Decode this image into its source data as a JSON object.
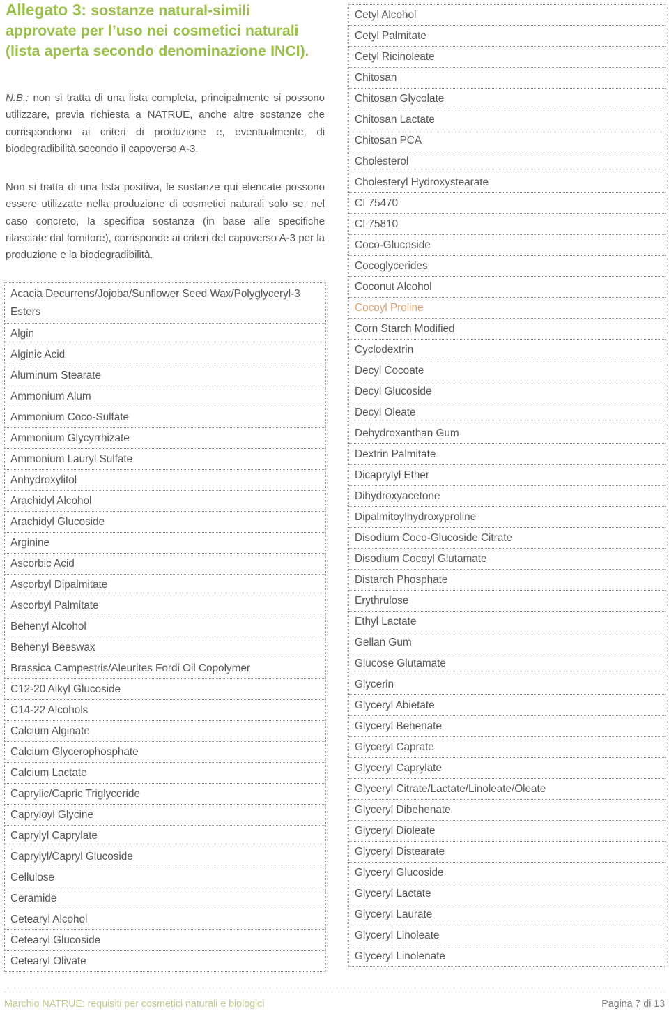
{
  "document": {
    "title_strong": "Allegato 3:",
    "title_rest": " sostanze natural-simili approvate per l’uso nei cosmetici naturali (lista aperta secondo denominazione INCI).",
    "nb_label": "N.B.:",
    "nb_text": " non si tratta di una lista completa, principalmente si possono utilizzare, previa richiesta a NATRUE, anche altre sostanze che corrispondono ai criteri di produzione e, eventualmente, di biodegradibilità secondo il capoverso A-3.",
    "paragraph_2": "Non si tratta di una lista positiva, le sostanze qui elencate possono essere utilizzate nella produzione di cosmetici naturali solo se, nel caso concreto, la specifica sostanza (in base alle specifiche rilasciate dal fornitore), corrisponde ai criteri del capoverso A-3 per la produzione e la biodegradibilità."
  },
  "colors": {
    "heading_green": "#9CC04C",
    "body_gray": "#58585A",
    "accent_tan": "#D9A273",
    "footer_green": "#BCCB8E",
    "footer_gray": "#808080",
    "dotted_rule": "#9A9A9A"
  },
  "substances_left": [
    "Acacia Decurrens/Jojoba/Sunflower Seed Wax/Polyglyceryl-3 Esters",
    "Algin",
    "Alginic Acid",
    "Aluminum Stearate",
    "Ammonium Alum",
    "Ammonium Coco-Sulfate",
    "Ammonium Glycyrrhizate",
    "Ammonium Lauryl Sulfate",
    "Anhydroxylitol",
    "Arachidyl Alcohol",
    "Arachidyl Glucoside",
    "Arginine",
    "Ascorbic Acid",
    "Ascorbyl Dipalmitate",
    "Ascorbyl Palmitate",
    "Behenyl Alcohol",
    "Behenyl Beeswax",
    "Brassica Campestris/Aleurites Fordi Oil Copolymer",
    "C12-20 Alkyl Glucoside",
    "C14-22 Alcohols",
    "Calcium Alginate",
    "Calcium Glycerophosphate",
    "Calcium Lactate",
    "Caprylic/Capric Triglyceride",
    "Capryloyl Glycine",
    "Caprylyl Caprylate",
    "Caprylyl/Capryl Glucoside",
    "Cellulose",
    "Ceramide",
    "Cetearyl Alcohol",
    "Cetearyl Glucoside",
    "Cetearyl Olivate"
  ],
  "substances_right": [
    "Cetyl Alcohol",
    "Cetyl Palmitate",
    "Cetyl Ricinoleate",
    "Chitosan",
    "Chitosan Glycolate",
    "Chitosan Lactate",
    "Chitosan PCA",
    "Cholesterol",
    "Cholesteryl Hydroxystearate",
    "CI 75470",
    "CI 75810",
    "Coco-Glucoside",
    "Cocoglycerides",
    "Coconut Alcohol",
    "Cocoyl Proline",
    "Corn Starch Modified",
    "Cyclodextrin",
    "Decyl Cocoate",
    "Decyl Glucoside",
    "Decyl Oleate",
    "Dehydroxanthan Gum",
    "Dextrin Palmitate",
    "Dicaprylyl Ether",
    "Dihydroxyacetone",
    "Dipalmitoylhydroxyproline",
    "Disodium Coco-Glucoside Citrate",
    "Disodium Cocoyl Glutamate",
    "Distarch Phosphate",
    "Erythrulose",
    "Ethyl Lactate",
    "Gellan Gum",
    "Glucose Glutamate",
    "Glycerin",
    "Glyceryl Abietate",
    "Glyceryl Behenate",
    "Glyceryl Caprate",
    "Glyceryl Caprylate",
    "Glyceryl Citrate/Lactate/Linoleate/Oleate",
    "Glyceryl Dibehenate",
    "Glyceryl Dioleate",
    "Glyceryl Distearate",
    "Glyceryl Glucoside",
    "Glyceryl Lactate",
    "Glyceryl Laurate",
    "Glyceryl Linoleate",
    "Glyceryl Linolenate"
  ],
  "highlighted_right_index": 14,
  "footer": {
    "left": "Marchio NATRUE: requisiti per cosmetici naturali e biologici",
    "right": "Pagina 7 di 13"
  }
}
